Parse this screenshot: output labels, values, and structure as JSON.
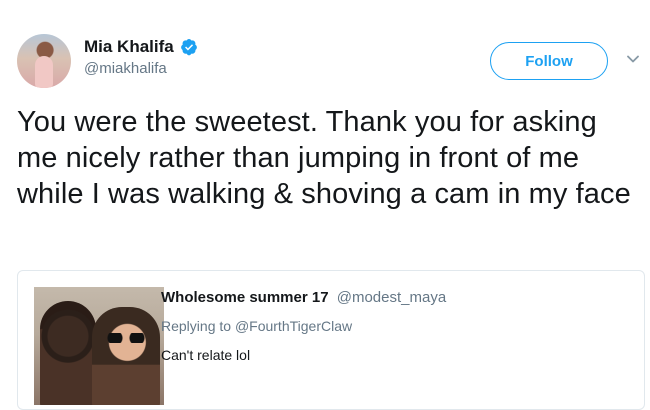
{
  "tweet": {
    "author_name": "Mia Khalifa",
    "author_handle": "@miakhalifa",
    "follow_label": "Follow",
    "text": "You were the sweetest. Thank you for asking me nicely rather than jumping in front of me while I was walking & shoving a cam in my face"
  },
  "quoted_tweet": {
    "author_name": "Wholesome summer 17",
    "author_handle": "@modest_maya",
    "replying_prefix": "Replying to",
    "replying_to": "@FourthTigerClaw",
    "text": "Can't relate lol"
  },
  "icons": {
    "verified": "verified-badge-icon",
    "more": "chevron-down-icon"
  },
  "colors": {
    "accent": "#1da1f2",
    "secondary_text": "#657786",
    "primary_text": "#14171a",
    "border": "#e1e8ed"
  }
}
